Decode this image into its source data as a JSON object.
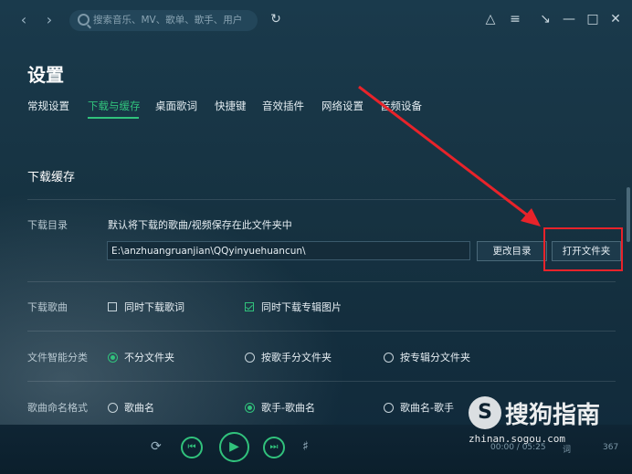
{
  "colors": {
    "accent": "#31c27c",
    "highlight": "#e8232a",
    "background": "#163241"
  },
  "titlebar": {
    "back_icon": "chevron-left-icon",
    "forward_icon": "chevron-right-icon",
    "search_placeholder": "搜索音乐、MV、歌单、歌手、用户",
    "icons": [
      "refresh-icon",
      "shirt-icon",
      "menu-icon",
      "mini-mode-icon",
      "minimize-icon",
      "maximize-icon",
      "close-icon"
    ]
  },
  "page": {
    "title": "设置"
  },
  "tabs": [
    {
      "label": "常规设置"
    },
    {
      "label": "下载与缓存",
      "active": true
    },
    {
      "label": "桌面歌词"
    },
    {
      "label": "快捷键"
    },
    {
      "label": "音效插件"
    },
    {
      "label": "网络设置"
    },
    {
      "label": "音频设备"
    }
  ],
  "section": {
    "title": "下载缓存",
    "download_dir": {
      "label": "下载目录",
      "description": "默认将下载的歌曲/视频保存在此文件夹中",
      "path": "E:\\anzhuangruanjian\\QQyinyuehuancun\\",
      "change_button": "更改目录",
      "open_button": "打开文件夹"
    },
    "download_songs": {
      "label": "下载歌曲",
      "options": [
        {
          "label": "同时下载歌词",
          "checked": false
        },
        {
          "label": "同时下载专辑图片",
          "checked": true
        }
      ]
    },
    "smart_classify": {
      "label": "文件智能分类",
      "options": [
        {
          "label": "不分文件夹",
          "checked": true
        },
        {
          "label": "按歌手分文件夹",
          "checked": false
        },
        {
          "label": "按专辑分文件夹",
          "checked": false
        }
      ]
    },
    "naming_format": {
      "label": "歌曲命名格式",
      "options": [
        {
          "label": "歌曲名",
          "checked": false
        },
        {
          "label": "歌手-歌曲名",
          "checked": true
        },
        {
          "label": "歌曲名-歌手",
          "checked": false
        }
      ]
    }
  },
  "player": {
    "icons": [
      "repeat-icon",
      "previous-icon",
      "play-icon",
      "next-icon",
      "volume-icon"
    ],
    "time": "00:00 / 05:25",
    "lyric_label": "词",
    "count": "367"
  },
  "watermark": {
    "logo_letter": "S",
    "brand": "搜狗指南",
    "url": "zhinan.sogou.com"
  }
}
